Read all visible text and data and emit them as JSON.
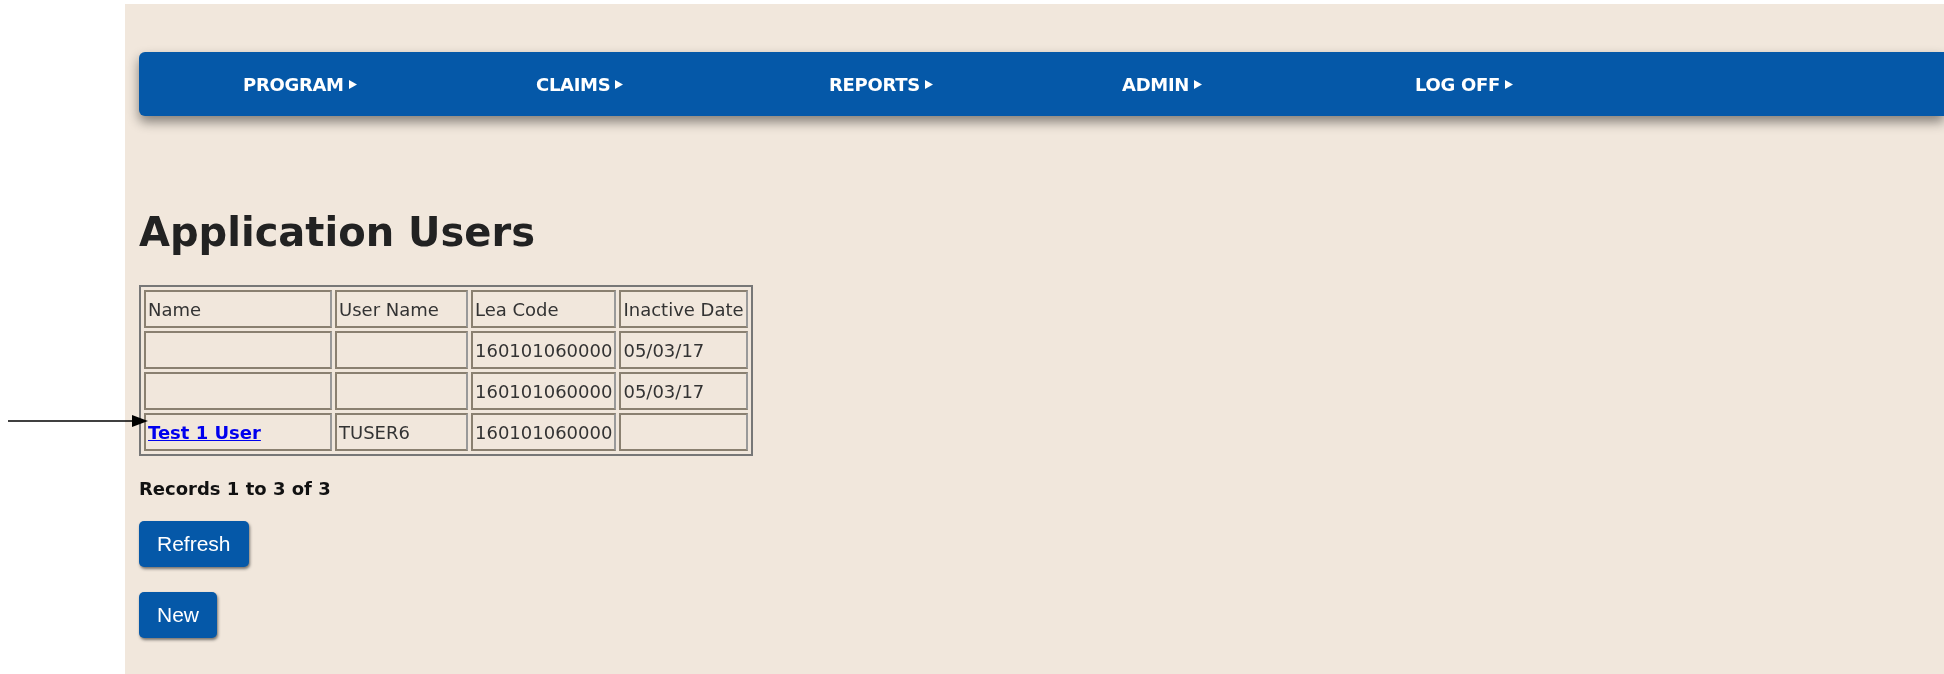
{
  "nav": [
    {
      "label": "PROGRAM"
    },
    {
      "label": "CLAIMS"
    },
    {
      "label": "REPORTS"
    },
    {
      "label": "ADMIN"
    },
    {
      "label": "LOG OFF"
    }
  ],
  "title": "Application Users",
  "table": {
    "columns": [
      "Name",
      "User Name",
      "Lea Code",
      "Inactive Date"
    ],
    "rows": [
      {
        "lea_code": "160101060000",
        "inactive_date": "05/03/17"
      },
      {
        "lea_code": "160101060000",
        "inactive_date": "05/03/17"
      },
      {
        "name": "Test 1 User",
        "user_name": "TUSER6",
        "lea_code": "160101060000"
      }
    ]
  },
  "records": "Records 1 to 3 of 3",
  "buttons": [
    "Refresh",
    "New"
  ]
}
